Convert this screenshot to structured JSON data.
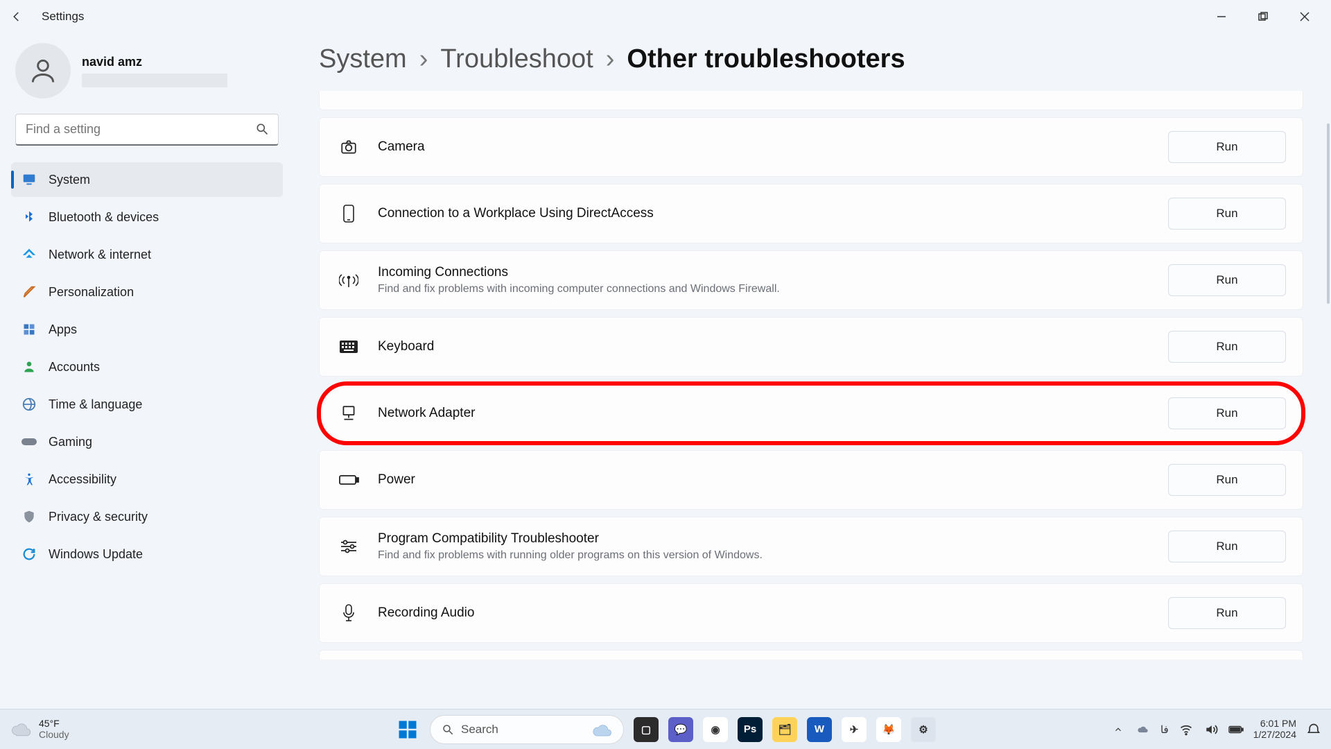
{
  "window": {
    "title": "Settings"
  },
  "profile": {
    "name": "navid amz"
  },
  "search": {
    "placeholder": "Find a setting"
  },
  "nav": {
    "items": [
      {
        "label": "System",
        "icon": "monitor",
        "active": true
      },
      {
        "label": "Bluetooth & devices",
        "icon": "bluetooth",
        "active": false
      },
      {
        "label": "Network & internet",
        "icon": "wifi",
        "active": false
      },
      {
        "label": "Personalization",
        "icon": "brush",
        "active": false
      },
      {
        "label": "Apps",
        "icon": "grid",
        "active": false
      },
      {
        "label": "Accounts",
        "icon": "person",
        "active": false
      },
      {
        "label": "Time & language",
        "icon": "globe-clock",
        "active": false
      },
      {
        "label": "Gaming",
        "icon": "gamepad",
        "active": false
      },
      {
        "label": "Accessibility",
        "icon": "accessibility",
        "active": false
      },
      {
        "label": "Privacy & security",
        "icon": "shield",
        "active": false
      },
      {
        "label": "Windows Update",
        "icon": "sync",
        "active": false
      }
    ]
  },
  "breadcrumb": {
    "parts": [
      "System",
      "Troubleshoot",
      "Other troubleshooters"
    ]
  },
  "troubleshooters": {
    "run_label": "Run",
    "items": [
      {
        "id": "camera",
        "icon": "camera",
        "title": "Camera",
        "desc": ""
      },
      {
        "id": "workplace",
        "icon": "phone",
        "title": "Connection to a Workplace Using DirectAccess",
        "desc": ""
      },
      {
        "id": "incoming",
        "icon": "antenna",
        "title": "Incoming Connections",
        "desc": "Find and fix problems with incoming computer connections and Windows Firewall."
      },
      {
        "id": "keyboard",
        "icon": "keyboard",
        "title": "Keyboard",
        "desc": ""
      },
      {
        "id": "network",
        "icon": "network",
        "title": "Network Adapter",
        "desc": "",
        "highlight": true
      },
      {
        "id": "power",
        "icon": "battery",
        "title": "Power",
        "desc": ""
      },
      {
        "id": "compat",
        "icon": "sliders",
        "title": "Program Compatibility Troubleshooter",
        "desc": "Find and fix problems with running older programs on this version of Windows."
      },
      {
        "id": "audio",
        "icon": "mic",
        "title": "Recording Audio",
        "desc": ""
      }
    ]
  },
  "taskbar": {
    "weather": {
      "temp": "45°F",
      "cond": "Cloudy"
    },
    "search_placeholder": "Search",
    "lang": "فا",
    "clock": {
      "time": "6:01 PM",
      "date": "1/27/2024"
    },
    "apps": [
      {
        "name": "task-view",
        "bg": "#2b2b2b",
        "glyph": "▢"
      },
      {
        "name": "teams",
        "bg": "#5b5fc7",
        "glyph": "💬"
      },
      {
        "name": "chrome",
        "bg": "#ffffff",
        "glyph": "◉"
      },
      {
        "name": "photoshop",
        "bg": "#001e36",
        "glyph": "Ps"
      },
      {
        "name": "file-explorer",
        "bg": "#ffd35a",
        "glyph": "🗂"
      },
      {
        "name": "word",
        "bg": "#185abd",
        "glyph": "W"
      },
      {
        "name": "telegram",
        "bg": "#ffffff",
        "glyph": "✈"
      },
      {
        "name": "firefox",
        "bg": "#ffffff",
        "glyph": "🦊"
      },
      {
        "name": "settings",
        "bg": "#dce3ec",
        "glyph": "⚙"
      }
    ]
  }
}
